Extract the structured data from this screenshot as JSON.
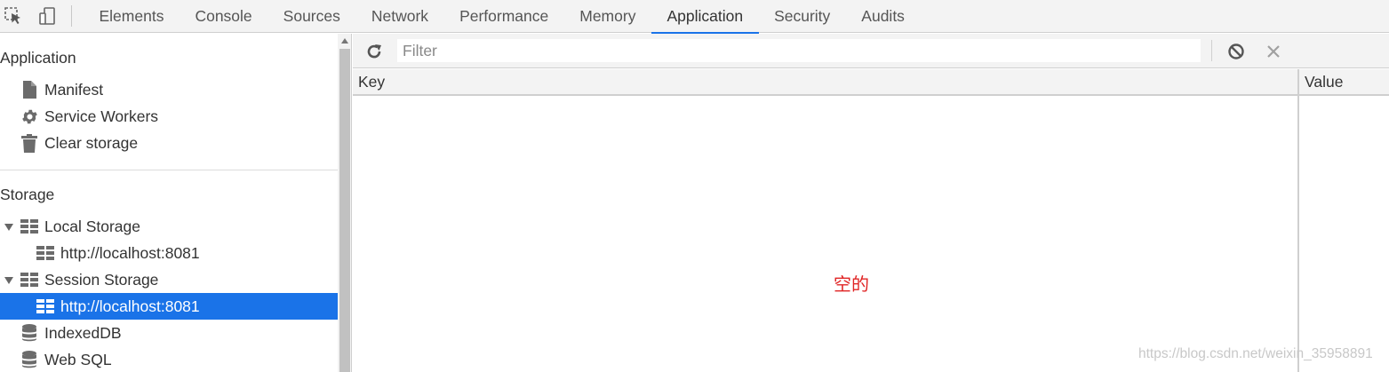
{
  "toolbar": {
    "tabs": [
      "Elements",
      "Console",
      "Sources",
      "Network",
      "Performance",
      "Memory",
      "Application",
      "Security",
      "Audits"
    ],
    "active_tab": "Application",
    "icons": [
      "inspect-element-icon",
      "device-toolbar-icon"
    ]
  },
  "sidebar": {
    "application_section": {
      "title": "Application",
      "items": [
        {
          "label": "Manifest",
          "icon": "document-icon"
        },
        {
          "label": "Service Workers",
          "icon": "gear-icon"
        },
        {
          "label": "Clear storage",
          "icon": "trash-icon"
        }
      ]
    },
    "storage_section": {
      "title": "Storage",
      "local_storage": {
        "label": "Local Storage",
        "child": "http://localhost:8081"
      },
      "session_storage": {
        "label": "Session Storage",
        "child": "http://localhost:8081"
      },
      "indexeddb": {
        "label": "IndexedDB"
      },
      "websql": {
        "label": "Web SQL"
      }
    }
  },
  "main": {
    "filter": {
      "placeholder": "Filter",
      "value": ""
    },
    "columns": {
      "key": "Key",
      "value": "Value"
    },
    "empty_note": "空的",
    "watermark": "https://blog.csdn.net/weixin_35958891"
  },
  "colors": {
    "accent": "#1a73e8",
    "note": "#e02424",
    "toolbar_bg": "#f3f3f3"
  }
}
